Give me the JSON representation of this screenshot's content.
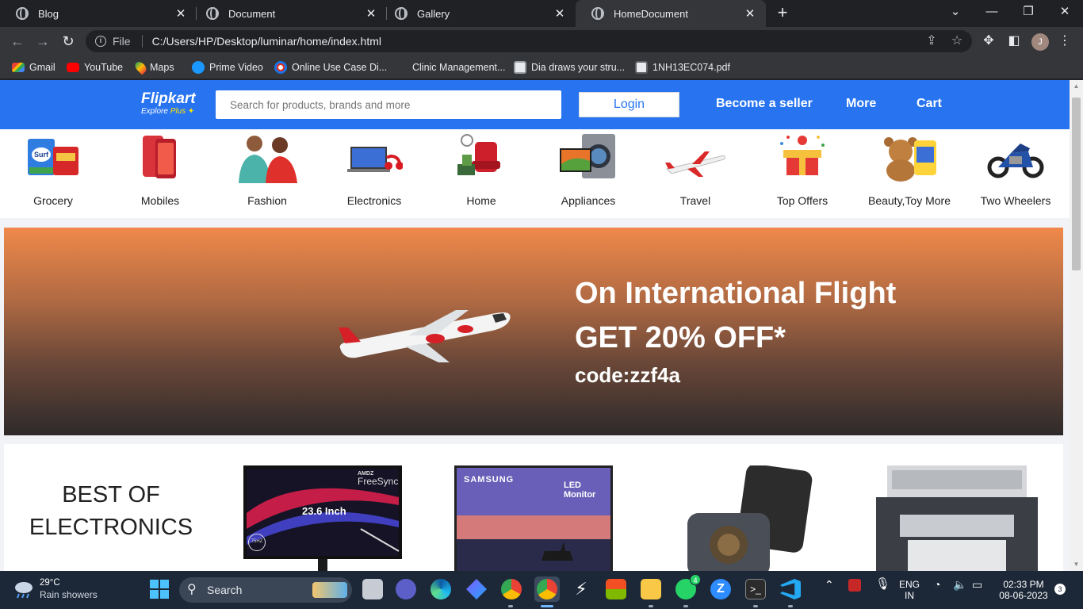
{
  "browser": {
    "tabs": [
      {
        "title": "Blog",
        "active": false
      },
      {
        "title": "Document",
        "active": false
      },
      {
        "title": "Gallery",
        "active": false
      },
      {
        "title": "HomeDocument",
        "active": true
      }
    ],
    "address": {
      "scheme": "File",
      "url": "C:/Users/HP/Desktop/luminar/home/index.html"
    },
    "profile_initial": "J",
    "bookmarks": [
      {
        "label": "Gmail",
        "icon": "gmail-icon"
      },
      {
        "label": "YouTube",
        "icon": "youtube-icon"
      },
      {
        "label": "Maps",
        "icon": "maps-icon"
      },
      {
        "label": "Prime Video",
        "icon": "prime-video-icon"
      },
      {
        "label": "Online Use Case Di...",
        "icon": "visual-paradigm-icon"
      },
      {
        "label": "Clinic Management...",
        "icon": ""
      },
      {
        "label": "Dia draws your stru...",
        "icon": "dia-icon"
      },
      {
        "label": "1NH13EC074.pdf",
        "icon": "pdf-icon"
      }
    ]
  },
  "header": {
    "logo": {
      "brand": "Flipkart",
      "tag": "Explore",
      "tag_plus": "Plus"
    },
    "search_placeholder": "Search for products, brands and more",
    "login": "Login",
    "links": [
      "Become a seller",
      "More",
      "Cart"
    ],
    "accent": "#2874f0"
  },
  "categories": [
    {
      "label": "Grocery",
      "icon": "grocery-icon"
    },
    {
      "label": "Mobiles",
      "icon": "mobiles-icon"
    },
    {
      "label": "Fashion",
      "icon": "fashion-icon"
    },
    {
      "label": "Electronics",
      "icon": "electronics-icon"
    },
    {
      "label": "Home",
      "icon": "home-furniture-icon"
    },
    {
      "label": "Appliances",
      "icon": "appliances-icon"
    },
    {
      "label": "Travel",
      "icon": "travel-icon"
    },
    {
      "label": "Top Offers",
      "icon": "top-offers-icon"
    },
    {
      "label": "Beauty,Toy More",
      "icon": "beauty-toys-icon"
    },
    {
      "label": "Two Wheelers",
      "icon": "two-wheelers-icon"
    }
  ],
  "banner": {
    "line1": "On International Flight",
    "line2": "GET 20% OFF*",
    "line3": "code:zzf4a"
  },
  "electronics": {
    "title": "BEST OF ELECTRONICS",
    "products": [
      {
        "name": "monitor",
        "text": "23.6 Inch",
        "badge_top": "AMDZ",
        "badge": "FreeSync",
        "hz": "75HZ"
      },
      {
        "name": "samsung-monitor",
        "brand": "SAMSUNG",
        "text": "LED Monitor"
      },
      {
        "name": "power-bank"
      },
      {
        "name": "printer"
      }
    ]
  },
  "taskbar": {
    "weather": {
      "temp": "29°C",
      "condition": "Rain showers"
    },
    "search": "Search",
    "language": [
      "ENG",
      "IN"
    ],
    "time": "02:33 PM",
    "date": "08-06-2023",
    "notifications": "3",
    "whatsapp_badge": "4"
  }
}
